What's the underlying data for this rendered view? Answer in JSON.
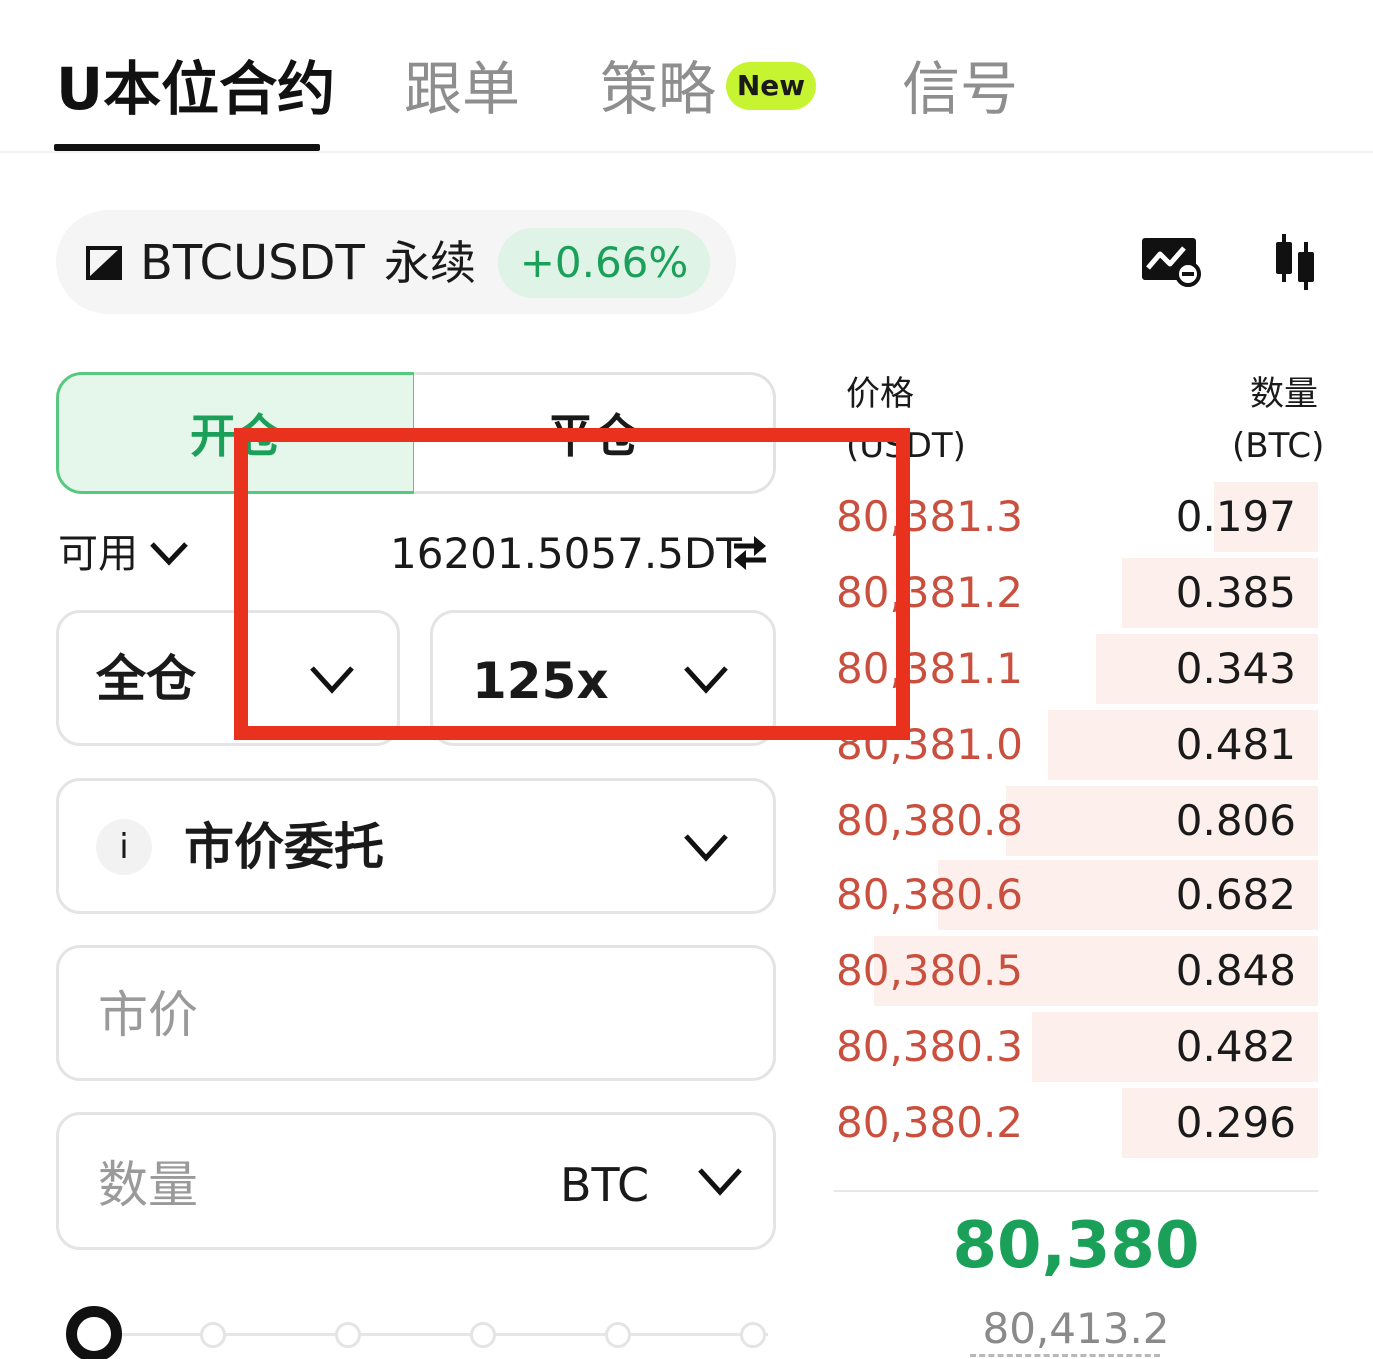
{
  "tabs": [
    {
      "label": "U本位合约",
      "active": true
    },
    {
      "label": "跟单",
      "active": false
    },
    {
      "label": "策略",
      "active": false,
      "badge": "New"
    },
    {
      "label": "信号",
      "active": false
    }
  ],
  "symbol": {
    "name": "BTCUSDT",
    "type": "永续",
    "change": "+0.66%",
    "icons": [
      "symbol-switch-icon",
      "chart-icon",
      "candlestick-icon"
    ]
  },
  "trade": {
    "open_label": "开仓",
    "close_label": "平仓",
    "available_label": "可用",
    "available_value": "16201.5057.5DT",
    "margin_mode": "全仓",
    "leverage": "125x",
    "order_type": "市价委托",
    "order_info": "i",
    "price_placeholder": "市价",
    "qty_placeholder": "数量",
    "qty_unit": "BTC"
  },
  "orderbook": {
    "price_header": "价格",
    "price_unit": "(USDT)",
    "qty_header": "数量",
    "qty_unit": "(BTC)",
    "asks": [
      {
        "price": "80,381.3",
        "qty": "0.197"
      },
      {
        "price": "80,381.2",
        "qty": "0.385"
      },
      {
        "price": "80,381.1",
        "qty": "0.343"
      },
      {
        "price": "80,381.0",
        "qty": "0.481"
      },
      {
        "price": "80,380.8",
        "qty": "0.806"
      },
      {
        "price": "80,380.6",
        "qty": "0.682"
      },
      {
        "price": "80,380.5",
        "qty": "0.848"
      },
      {
        "price": "80,380.3",
        "qty": "0.482"
      },
      {
        "price": "80,380.2",
        "qty": "0.296"
      }
    ],
    "last_price": "80,380",
    "mark_price": "80,413.2"
  },
  "colors": {
    "green": "#1ba05a",
    "red": "#c9503f",
    "badge": "#c6f431",
    "annotation": "#e8321e"
  }
}
